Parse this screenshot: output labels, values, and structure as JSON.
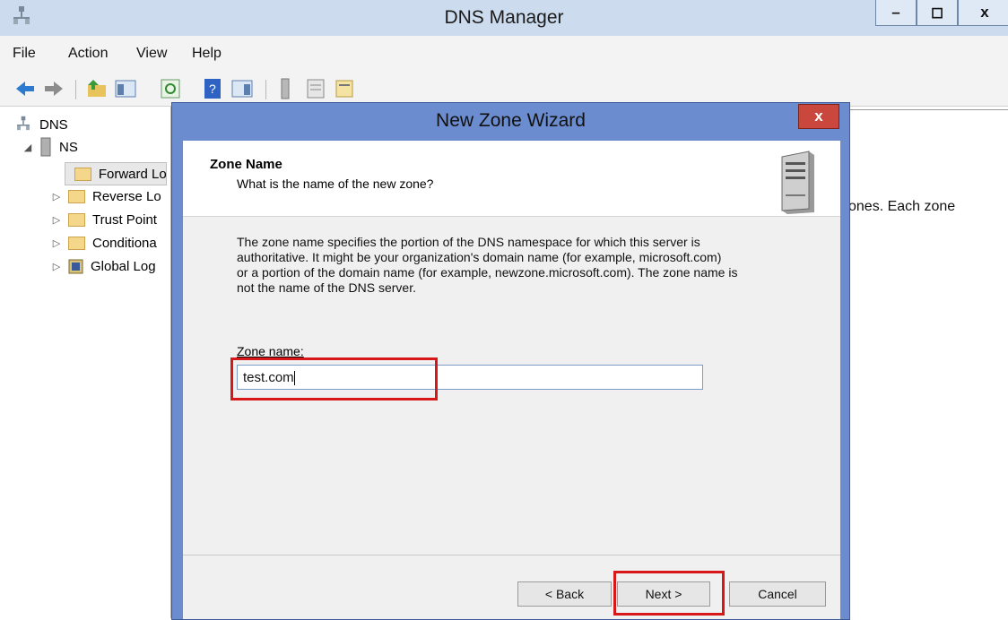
{
  "window": {
    "title": "DNS Manager",
    "minimize": "–",
    "maximize": "◻",
    "close": "x"
  },
  "menu": [
    "File",
    "Action",
    "View",
    "Help"
  ],
  "tree": {
    "root": "DNS",
    "server": "NS",
    "items": [
      "Forward Lo",
      "Reverse Lo",
      "Trust Point",
      "Conditiona",
      "Global Log"
    ]
  },
  "right_pane": {
    "text": "ones. Each zone"
  },
  "dialog": {
    "title": "New Zone Wizard",
    "close": "x",
    "header_title": "Zone Name",
    "header_subtitle": "What is the name of the new zone?",
    "description_lines": [
      "The zone name specifies the portion of the DNS namespace for which this server is",
      "authoritative. It might be your organization's domain name (for example,  microsoft.com)",
      "or a portion of the domain name (for example, newzone.microsoft.com). The zone name is",
      "not the name of the DNS server."
    ],
    "zone_label": "Zone name:",
    "zone_value": "test.com",
    "back_label": "< Back",
    "next_label": "Next >",
    "cancel_label": "Cancel"
  },
  "colors": {
    "highlight": "#d81818",
    "dialog_frame": "#6b8ccf",
    "titlebar": "#ccdcee"
  }
}
